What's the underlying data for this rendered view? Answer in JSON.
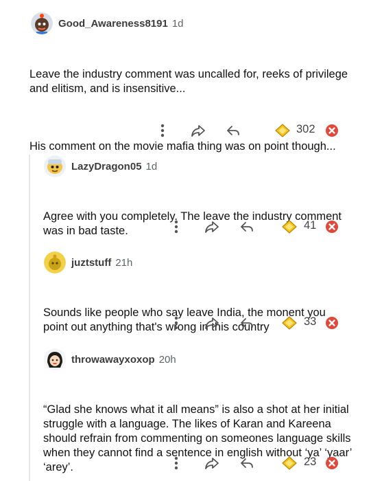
{
  "comments": [
    {
      "username": "Good_Awareness8191",
      "age": "1d",
      "paragraphs": [
        "Leave the industry comment was uncalled for, reeks of privilege and elitism, and is insensitive...",
        "His comment on the movie mafia thing was on point though..."
      ],
      "score": "302"
    },
    {
      "username": "LazyDragon05",
      "age": "1d",
      "paragraphs": [
        "Agree with you completely. The leave the industry comment was in bad taste."
      ],
      "score": "41"
    },
    {
      "username": "juztstuff",
      "age": "21h",
      "paragraphs": [
        "Sounds like people who say leave India, the monent you point out anything that's wrong in this country"
      ],
      "score": "33"
    },
    {
      "username": "throwawayxoxop",
      "age": "20h",
      "paragraphs": [
        "“Glad she knows what it all means” is also a shot at her initial struggle with a language. The likes of Karan and Kareena should refrain from commenting on someones language skills when they cannot find a sentence in english without ‘ya’ ‘yaar’ ‘arey’."
      ],
      "score": "23"
    }
  ],
  "colors": {
    "award_gold": "#f5c518",
    "downvote_red": "#e2473a"
  },
  "icons": {
    "more": "more-options-icon",
    "share": "share-icon",
    "reply": "reply-icon",
    "award": "award-icon",
    "downvote": "downvote-icon"
  }
}
